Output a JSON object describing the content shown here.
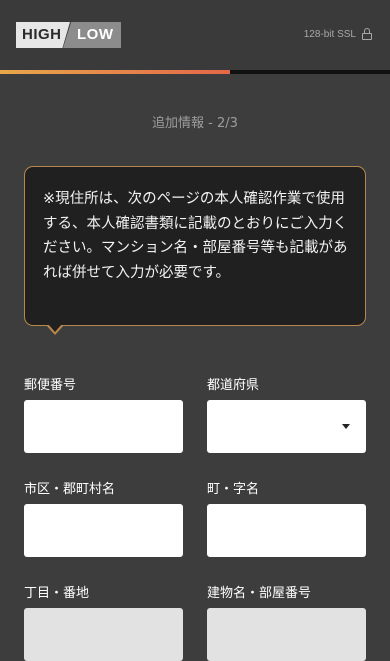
{
  "header": {
    "logo_high": "HIGH",
    "logo_low": "LOW",
    "ssl_text": "128-bit SSL",
    "lock_icon": "lock-icon"
  },
  "progress": {
    "fraction": 0.59,
    "colors": [
      "#e8a74a",
      "#e4674a"
    ]
  },
  "step_label": "追加情報 - 2/3",
  "notice": {
    "text": "※現住所は、次のページの本人確認作業で使用する、本人確認書類に記載のとおりにご入力ください。マンション名・部屋番号等も記載があれば併せて入力が必要です。",
    "border_color": "#b8874c"
  },
  "form": {
    "postal_code": {
      "label": "郵便番号",
      "value": ""
    },
    "prefecture": {
      "label": "都道府県",
      "value": ""
    },
    "city": {
      "label": "市区・郡町村名",
      "value": ""
    },
    "town": {
      "label": "町・字名",
      "value": ""
    },
    "block": {
      "label": "丁目・番地",
      "value": ""
    },
    "building": {
      "label": "建物名・部屋番号",
      "value": ""
    }
  }
}
